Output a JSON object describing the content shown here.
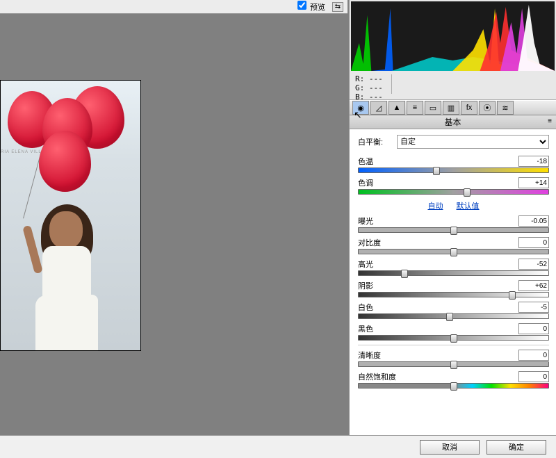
{
  "top": {
    "preview_label": "预览"
  },
  "rgb": {
    "r_label": "R:",
    "g_label": "G:",
    "b_label": "B:",
    "r_val": "---",
    "g_val": "---",
    "b_val": "---"
  },
  "section": {
    "title": "基本"
  },
  "wb": {
    "label": "白平衡:",
    "value": "自定"
  },
  "sliders": {
    "temp": {
      "label": "色温",
      "value": "-18",
      "pos": 41
    },
    "tint": {
      "label": "色调",
      "value": "+14",
      "pos": 57
    },
    "exposure": {
      "label": "曝光",
      "value": "-0.05",
      "pos": 50
    },
    "contrast": {
      "label": "对比度",
      "value": "0",
      "pos": 50
    },
    "highlights": {
      "label": "高光",
      "value": "-52",
      "pos": 24
    },
    "shadows": {
      "label": "阴影",
      "value": "+62",
      "pos": 81
    },
    "whites": {
      "label": "白色",
      "value": "-5",
      "pos": 48
    },
    "blacks": {
      "label": "黑色",
      "value": "0",
      "pos": 50
    },
    "clarity": {
      "label": "清晰度",
      "value": "0",
      "pos": 50
    },
    "vibrance": {
      "label": "自然饱和度",
      "value": "0",
      "pos": 50
    }
  },
  "links": {
    "auto": "自动",
    "default": "默认值"
  },
  "buttons": {
    "cancel": "取消",
    "ok": "确定"
  },
  "photo_sign": "RIA ELENA VILLAMIL"
}
